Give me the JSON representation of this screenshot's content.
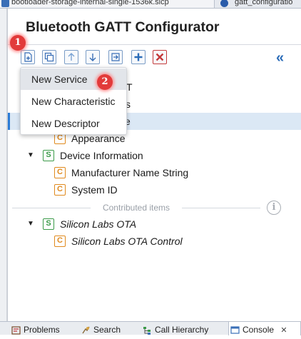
{
  "editor_tabs": [
    {
      "label": "bootloader-storage-internal-single-1536k.slcp",
      "icon": "project-icon"
    },
    {
      "label": "gatt_configuratio",
      "icon": "gatt-icon"
    }
  ],
  "title": "Bluetooth GATT Configurator",
  "toolbar": {
    "buttons": [
      {
        "name": "add-item-button",
        "icon": "add-file-icon"
      },
      {
        "name": "duplicate-button",
        "icon": "duplicate-icon"
      },
      {
        "name": "move-up-button",
        "icon": "arrow-up-icon"
      },
      {
        "name": "move-down-button",
        "icon": "arrow-down-icon"
      },
      {
        "name": "import-button",
        "icon": "import-icon"
      },
      {
        "name": "add-button",
        "icon": "plus-icon"
      },
      {
        "name": "delete-button",
        "icon": "delete-x-icon"
      }
    ],
    "collapse_icon": "collapse-double-chevron-icon"
  },
  "context_menu": {
    "items": [
      "New Service",
      "New Characteristic",
      "New Descriptor"
    ],
    "highlighted": "New Service"
  },
  "tree": {
    "partial_rows": [
      {
        "text": "T"
      },
      {
        "text": "s"
      },
      {
        "text": "e"
      }
    ],
    "items": [
      {
        "badge": "C",
        "label": "Appearance"
      },
      {
        "badge": "S",
        "label": "Device Information"
      },
      {
        "badge": "C",
        "label": "Manufacturer Name String"
      },
      {
        "badge": "C",
        "label": "System ID"
      },
      {
        "badge": "S",
        "label": "Silicon Labs OTA"
      },
      {
        "badge": "C",
        "label": "Silicon Labs OTA Control"
      }
    ],
    "contributed_label": "Contributed items",
    "info_icon": "i"
  },
  "markers": [
    "1",
    "2"
  ],
  "bottom_tabs": [
    {
      "label": "Problems",
      "icon": "problems-icon"
    },
    {
      "label": "Search",
      "icon": "search-icon"
    },
    {
      "label": "Call Hierarchy",
      "icon": "call-hierarchy-icon"
    },
    {
      "label": "Console",
      "close": "✕",
      "icon": "console-icon"
    }
  ],
  "colors": {
    "accent": "#2b6cb8",
    "service_badge": "#3a9a48",
    "characteristic_badge": "#e08a1e",
    "marker": "#e23a3a",
    "selection": "#dbe8f5"
  }
}
